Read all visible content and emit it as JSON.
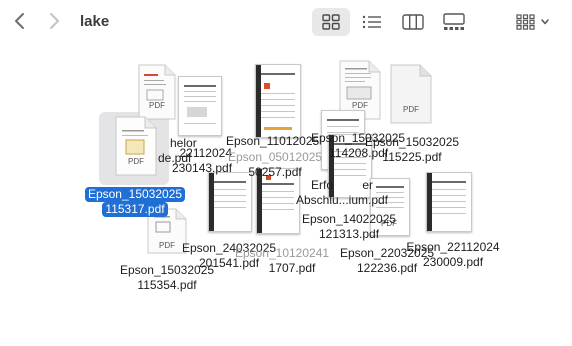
{
  "window": {
    "title": "lake"
  },
  "toolbar": {
    "back": "chevron-left-icon",
    "forward": "chevron-right-icon",
    "views": [
      "grid-view-icon",
      "list-view-icon",
      "column-view-icon",
      "gallery-view-icon"
    ],
    "group": "group-by-icon"
  },
  "colors": {
    "selection": "#1f6fd4",
    "selection_bg": "#e4e4e6",
    "text": "#1d1d1f"
  },
  "pdf_badge": "PDF",
  "files": {
    "f1": {
      "name": "Epson_15032025 115317.pdf",
      "l1": "Epson_15032025",
      "l2": "115317.pdf"
    },
    "f2": {
      "name": "Bachelor...Guide.pdf",
      "l1": "helor",
      "l2": "de.pdf"
    },
    "f3": {
      "name": "...22112024 230143.pdf",
      "l1": "22112024",
      "l2": "230143.pdf"
    },
    "f4": {
      "name": "Epson_11012025 ...",
      "l1": "Epson_11012025"
    },
    "f5": {
      "name": "Epson_05012025 ...50257.pdf",
      "l1": "Epson_05012025",
      "l2": "50257.pdf"
    },
    "f6": {
      "name": "Epson_15032025 114208.pdf",
      "l1": "Epson_15032025",
      "l2": "114208.pdf"
    },
    "f7": {
      "name": "Epson_15032025 115225.pdf",
      "l1": "Epson_15032025",
      "l2": "115225.pdf"
    },
    "f8": {
      "name": "Erfo...er Abschlu...ium.pdf",
      "l1": "Erfo",
      "l1b": "er",
      "l2": "Abschlu...ium.pdf"
    },
    "f9": {
      "name": "Epson_14022025 121313.pdf",
      "l1": "Epson_14022025",
      "l2": "121313.pdf"
    },
    "f10": {
      "name": "Epson_24032025 201541.pdf",
      "l1": "Epson_24032025",
      "l2": "201541.pdf"
    },
    "f11": {
      "name": "Epson_10120241 ...1707.pdf",
      "l1": "Epson_10120241",
      "l2": "1707.pdf"
    },
    "f12": {
      "name": "Epson_22032025 122236.pdf",
      "l1": "Epson_22032025",
      "l2": "122236.pdf"
    },
    "f13": {
      "name": "Epson_22112024 230009.pdf",
      "l1": "Epson_22112024",
      "l2": "230009.pdf"
    },
    "f14": {
      "name": "Epson_15032025 115354.pdf",
      "l1": "Epson_15032025",
      "l2": "115354.pdf"
    }
  }
}
